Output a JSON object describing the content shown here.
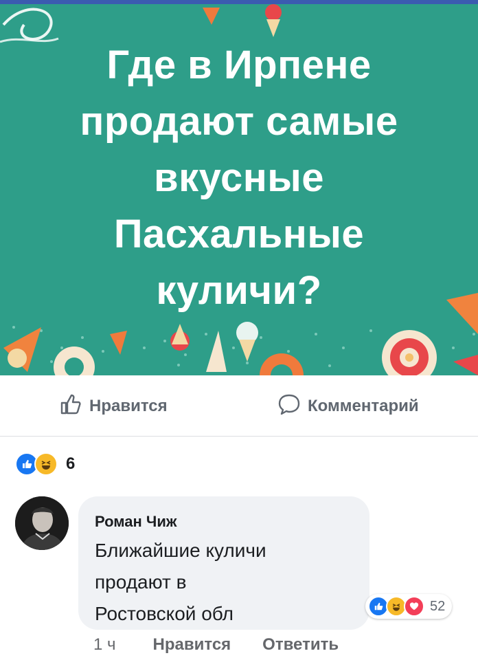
{
  "post": {
    "title_lines": [
      "Где в Ирпене",
      "продают самые",
      "вкусные",
      "Пасхальные",
      "куличи?"
    ]
  },
  "actions": {
    "like_label": "Нравится",
    "comment_label": "Комментарий"
  },
  "post_reactions": {
    "icons": [
      "like-icon",
      "haha-icon"
    ],
    "count": "6"
  },
  "comment": {
    "author": "Роман Чиж",
    "text_lines": [
      "Ближайшие куличи",
      "продают в",
      "Ростовской обл"
    ],
    "reactions": {
      "icons": [
        "like-icon",
        "haha-icon",
        "love-icon"
      ],
      "count": "52"
    },
    "time": "1 ч",
    "like_label": "Нравится",
    "reply_label": "Ответить"
  },
  "colors": {
    "banner_bg": "#2e9e89",
    "like_blue": "#1877f2",
    "haha_yellow": "#f7b928",
    "love_red": "#f33e58"
  }
}
